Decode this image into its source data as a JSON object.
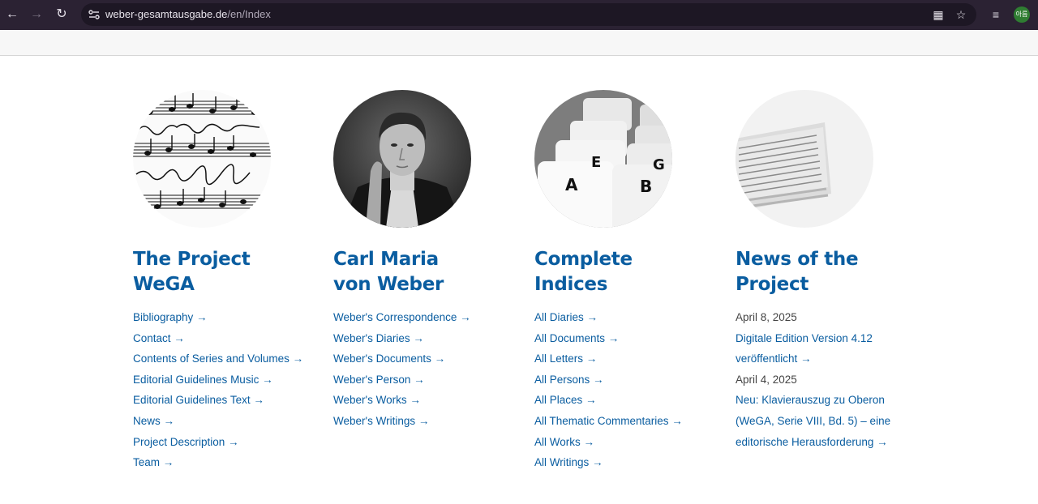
{
  "browser": {
    "url_host": "weber-gesamtausgabe.de",
    "url_path": "/en/Index",
    "profile_initials": "아름"
  },
  "columns": [
    {
      "title_line1": "The Project",
      "title_line2": "WeGA",
      "image": "music-manuscript",
      "links": [
        "Bibliography →",
        "Contact →",
        "Contents of Series and Volumes →",
        "Editorial Guidelines Music →",
        "Editorial Guidelines Text →",
        "News →",
        "Project Description →",
        "Team →"
      ]
    },
    {
      "title_line1": "Carl Maria",
      "title_line2": "von Weber",
      "image": "weber-portrait",
      "links": [
        "Weber's Correspondence →",
        "Weber's Diaries →",
        "Weber's Documents →",
        "Weber's Person →",
        "Weber's Works →",
        "Weber's Writings →"
      ]
    },
    {
      "title_line1": "Complete",
      "title_line2": "Indices",
      "image": "index-cards",
      "card_letters": [
        "A",
        "B",
        "E",
        "G"
      ],
      "links": [
        "All Diaries →",
        "All Documents →",
        "All Letters →",
        "All Persons →",
        "All Places →",
        "All Thematic Commentaries →",
        "All Works →",
        "All Writings →"
      ]
    },
    {
      "title_line1": "News of the",
      "title_line2": "Project",
      "image": "newspapers",
      "news": [
        {
          "date": "April 8, 2025",
          "line1": "Digitale Edition Version 4.12",
          "line2": "veröffentlicht →"
        },
        {
          "date": "April 4, 2025",
          "line1": "Neu: Klavierauszug zu Oberon",
          "line2": "(WeGA, Serie VIII, Bd. 5) – eine",
          "line3": "editorische Herausforderung →"
        }
      ]
    }
  ],
  "icons": [
    "back-arrow-icon",
    "forward-arrow-icon",
    "reload-icon",
    "site-settings-icon",
    "translate-icon",
    "bookmark-star-icon",
    "media-control-icon"
  ]
}
